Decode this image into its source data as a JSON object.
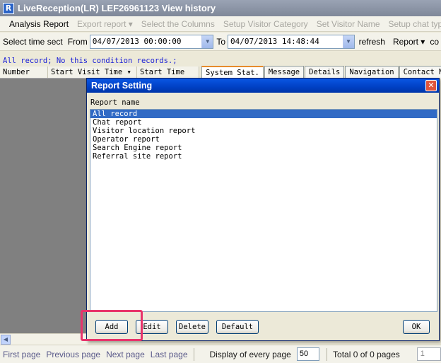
{
  "window": {
    "title": "LiveReception(LR) LEF26961123  View history",
    "icon_letter": "R"
  },
  "menu": {
    "items": [
      {
        "label": "Analysis Report",
        "enabled": true
      },
      {
        "label": "Export report  ▾",
        "enabled": false
      },
      {
        "label": "Select the Columns",
        "enabled": false
      },
      {
        "label": "Setup Visitor Category",
        "enabled": false
      },
      {
        "label": "Set Visitor Name",
        "enabled": false
      },
      {
        "label": "Setup chat type",
        "enabled": false
      }
    ]
  },
  "filter": {
    "select_time_label": "Select time sect",
    "from_label": "From",
    "from_value": "04/07/2013 00:00:00",
    "to_label": "To",
    "to_value": "04/07/2013 14:48:44",
    "refresh_label": "refresh",
    "report_label": "Report  ▾",
    "trailing": "co"
  },
  "status_line": "All record;   No this condition records.;",
  "grid": {
    "columns": [
      "Number",
      "Start Visit Time ▾",
      "Start Time"
    ]
  },
  "tabs": [
    "System Stat.",
    "Message",
    "Details",
    "Navigation",
    "Contact Man"
  ],
  "pager": {
    "first": "First page",
    "previous": "Previous page",
    "next": "Next page",
    "last": "Last page",
    "per_page_label": "Display of every page",
    "per_page_value": "50",
    "total": "Total 0 of 0 pages",
    "page_value": "1"
  },
  "dialog": {
    "title": "Report Setting",
    "caption": "Report name",
    "items": [
      "All record",
      "Chat report",
      "Visitor location report",
      "Operator report",
      "Search Engine report",
      "Referral site report"
    ],
    "selected_index": 0,
    "buttons": {
      "add": "Add",
      "edit": "Edit",
      "delete": "Delete",
      "default": "Default",
      "ok": "OK"
    }
  },
  "colors": {
    "highlight": "#e8336b",
    "selection": "#316ac5",
    "link_text": "#1a1fd6"
  }
}
